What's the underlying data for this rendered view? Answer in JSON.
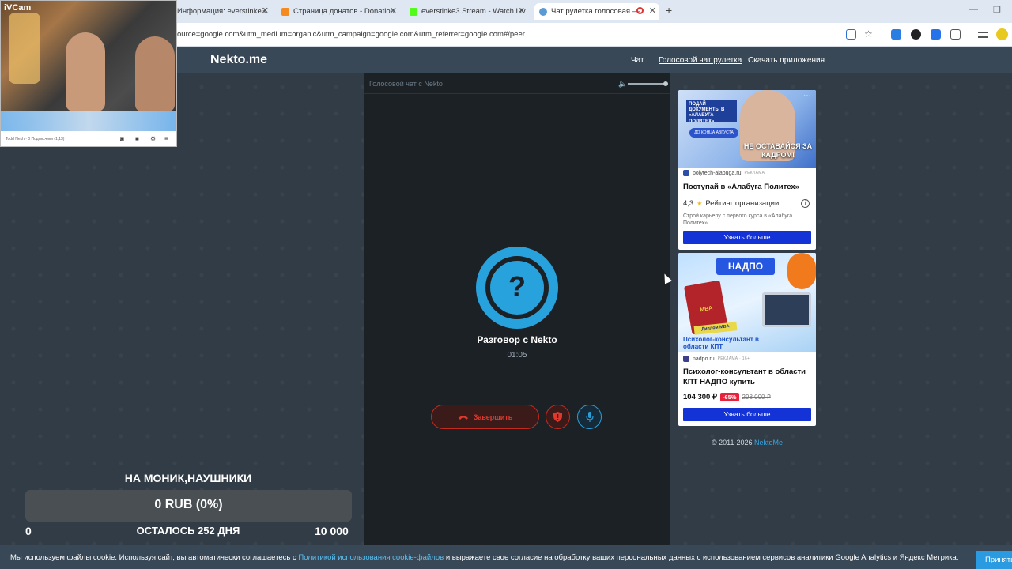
{
  "browser": {
    "tabs": [
      {
        "label": "Информация: everstinke3",
        "color": "#4a7cd9",
        "active": false
      },
      {
        "label": "Страница донатов - Donation",
        "color": "#f58a1f",
        "active": false
      },
      {
        "label": "everstinke3 Stream - Watch Liv",
        "color": "#53fc18",
        "active": false
      },
      {
        "label": "Чат рулетка голосовая — ",
        "color": "#5b9bd5",
        "active": true
      }
    ],
    "new_tab": "+",
    "url": "ource=google.com&utm_medium=organic&utm_campaign=google.com&utm_referrer=google.com#/peer"
  },
  "webcam": {
    "label": "iVCam",
    "footer_text": "Todd Nekh · 0 Подписчики (1,13)"
  },
  "site": {
    "logo": "Nekto.me",
    "nav": [
      {
        "label": "Чат",
        "active": false
      },
      {
        "label": "Голосовой чат рулетка",
        "active": true
      },
      {
        "label": "Скачать приложения",
        "active": false
      }
    ]
  },
  "voice_panel": {
    "title": "Голосовой чат с Nekto",
    "volume_level": 1.0,
    "avatar_symbol": "?",
    "talk_label": "Разговор с Nekto",
    "timer": "01:05",
    "end_button": "Завершить",
    "accent": "#28a2dc",
    "danger": "#e0392c"
  },
  "ads": {
    "ad1": {
      "badge": "ПОДАЙ ДОКУМЕНТЫ В «АЛАБУГА ПОЛИТЕХ»",
      "badge2": "ДО КОНЦА АВГУСТА",
      "slogan": "НЕ ОСТАВАЙСЯ ЗА КАДРОМ!",
      "source": "polytech-alabuga.ru",
      "ad_mark": "РЕКЛАМА",
      "title": "Поступай в «Алабуга Политех»",
      "rating": "4,3",
      "rating_label": "Рейтинг организации",
      "description": "Строй карьеру с первого курса в «Алабуга Политех»",
      "cta": "Узнать больше"
    },
    "ad2": {
      "brand": "НАДПО",
      "book_label": "MBA",
      "tag": "Диплом MBA",
      "caption": "Психолог-консультант в области КПТ",
      "source": "nadpo.ru",
      "ad_mark": "РЕКЛАМА · 16+",
      "title": "Психолог-консультант в области КПТ НАДПО купить",
      "price": "104 300 ₽",
      "discount": "-65%",
      "old_price": "298 000 ₽",
      "cta": "Узнать больше"
    }
  },
  "footer": {
    "copyright": "© 2011-2026 ",
    "link": "NektoMe"
  },
  "donation": {
    "title": "НА МОНИК,НАУШНИКИ",
    "amount": "0 RUB (0%)",
    "progress": 0,
    "min": "0",
    "remaining": "ОСТАЛОСЬ 252 ДНЯ",
    "max": "10 000"
  },
  "cookie": {
    "text_before": "Мы используем файлы cookie. Используя сайт, вы автоматически соглашаетесь с ",
    "link": "Политикой использования cookie-файлов",
    "text_after": " и выражаете свое согласие на обработку ваших персональных данных с использованием сервисов аналитики Google Analytics и Яндекс Метрика.",
    "accept": "Принять"
  }
}
